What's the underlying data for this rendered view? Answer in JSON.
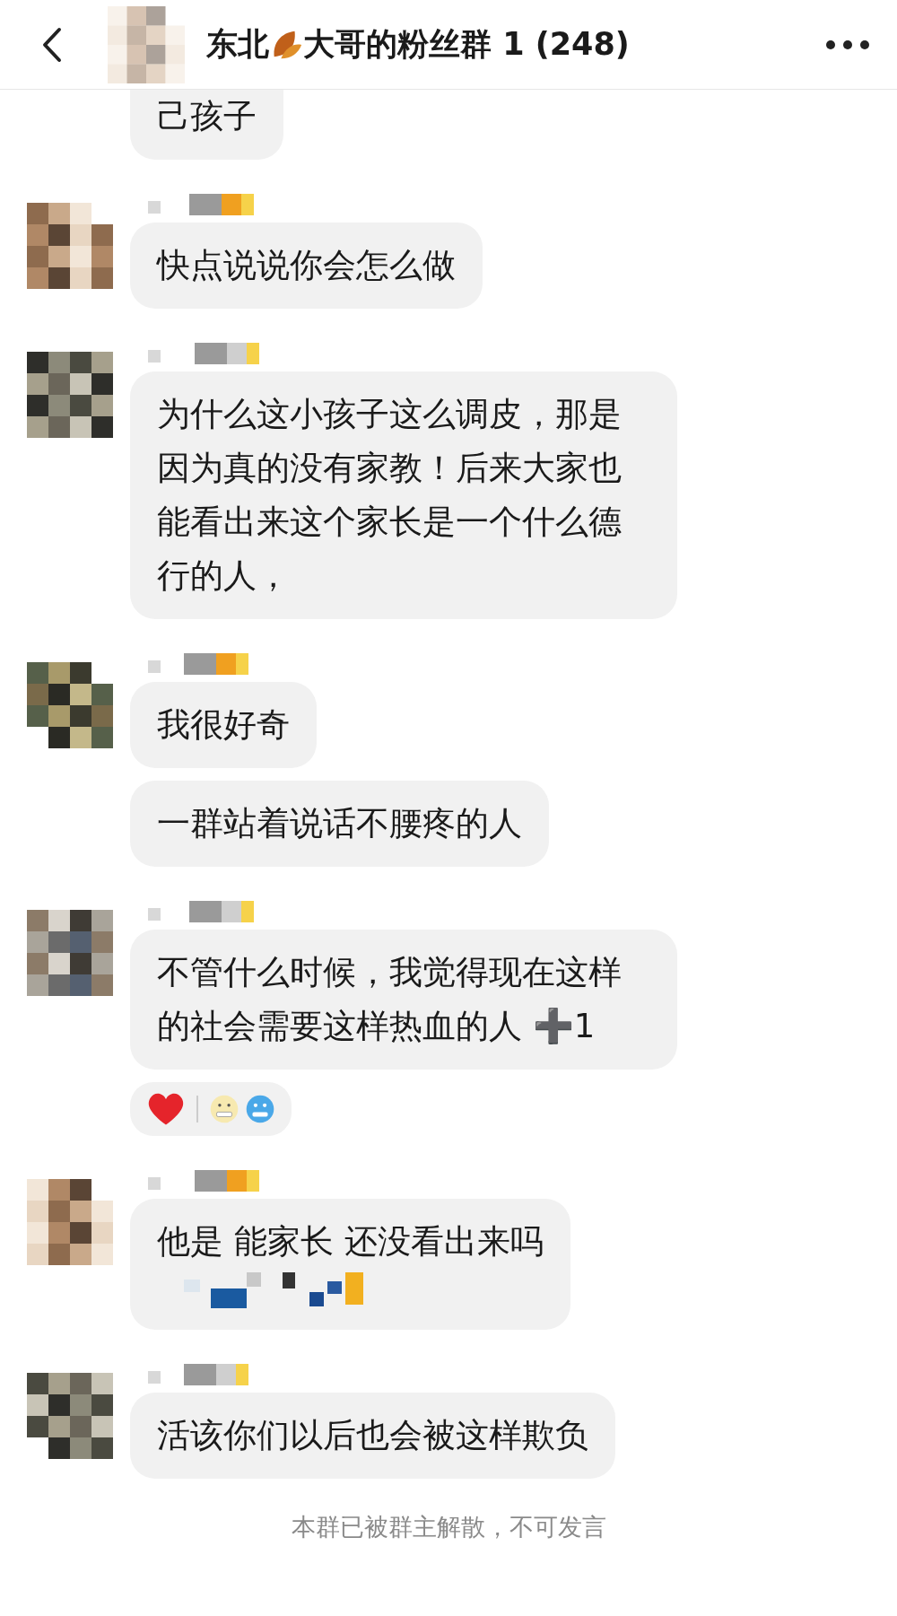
{
  "header": {
    "title_start": "东北",
    "title_end": "大哥的粉丝群 1 (248)"
  },
  "groups": [
    {
      "has_sender": false,
      "bubbles": [
        {
          "text": "己孩子",
          "mosaic_line": false
        }
      ]
    },
    {
      "has_sender": true,
      "bubbles": [
        {
          "text": "快点说说你会怎么做",
          "mosaic_line": false
        }
      ]
    },
    {
      "has_sender": true,
      "bubbles": [
        {
          "text": "为什么这小孩子这么调皮，那是因为真的没有家教！后来大家也能看出来这个家长是一个什么德行的人，",
          "mosaic_line": false
        }
      ]
    },
    {
      "has_sender": true,
      "bubbles": [
        {
          "text": "我很好奇",
          "mosaic_line": false
        },
        {
          "text": "一群站着说话不腰疼的人",
          "mosaic_line": false
        }
      ]
    },
    {
      "has_sender": true,
      "bubbles": [
        {
          "text": "不管什么时候，我觉得现在这样的社会需要这样热血的人 ➕1",
          "mosaic_line": false
        }
      ],
      "reactions": [
        {
          "kind": "heart"
        },
        {
          "kind": "grimace"
        },
        {
          "kind": "cold"
        }
      ]
    },
    {
      "has_sender": true,
      "bubbles": [
        {
          "text": "他是 能家长 还没看出来吗",
          "mosaic_line": true
        }
      ]
    },
    {
      "has_sender": true,
      "bubbles": [
        {
          "text": "活该你们以后也会被这样欺负",
          "mosaic_line": false
        }
      ]
    }
  ],
  "notice": "本群已被群主解散，不可发言"
}
